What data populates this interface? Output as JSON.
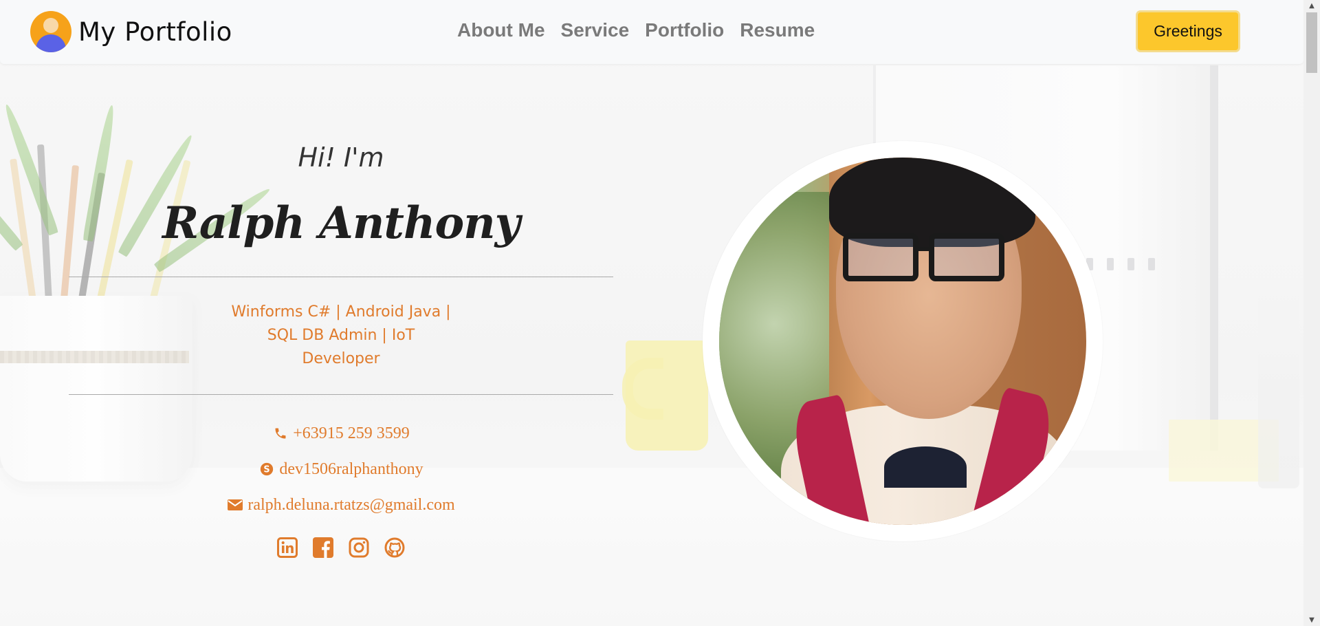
{
  "brand": {
    "name": "My Portfolio",
    "logo_icon": "person-avatar-icon"
  },
  "nav": {
    "links": [
      "About Me",
      "Service",
      "Portfolio",
      "Resume"
    ],
    "cta_label": "Greetings"
  },
  "hero": {
    "greeting": "Hi! I'm",
    "name": "Ralph Anthony",
    "roles_line1": "Winforms C# | Android Java |",
    "roles_line2": "SQL DB Admin | IoT",
    "roles_line3": "Developer",
    "contacts": {
      "phone": "+63915 259 3599",
      "skype": "dev1506ralphanthony",
      "email": "ralph.deluna.rtatzs@gmail.com"
    },
    "socials": [
      "linkedin-icon",
      "facebook-icon",
      "instagram-icon",
      "github-icon"
    ]
  },
  "colors": {
    "accent": "#e07b2c",
    "cta": "#fcc72c",
    "nav_text": "#7a7a7a"
  }
}
